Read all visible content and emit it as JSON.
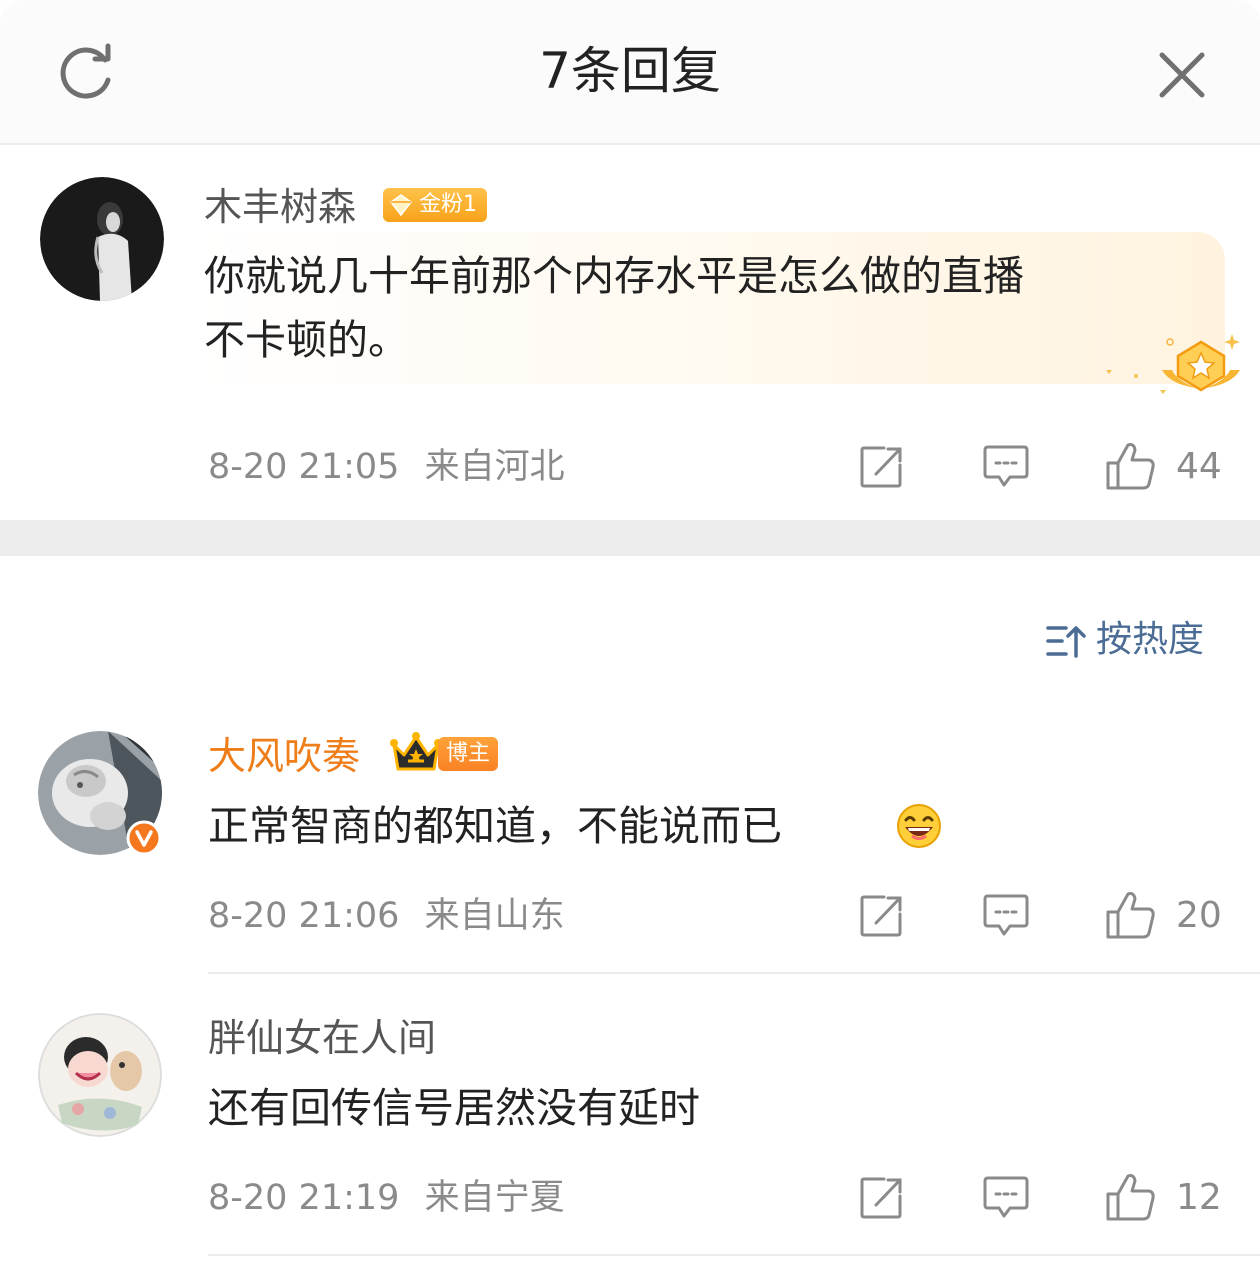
{
  "header": {
    "title": "7条回复"
  },
  "root_comment": {
    "user_name": "木丰树森",
    "fan_badge": "金粉1",
    "content_line1": "你就说几十年前那个内存水平是怎么做的直播",
    "content_line2": "不卡顿的。",
    "time": "8-20 21:05",
    "location": "来自河北",
    "likes": "44"
  },
  "sort": {
    "label": "按热度"
  },
  "replies": [
    {
      "user_name": "大风吹奏",
      "owner_badge": "博主",
      "content": "正常智商的都知道，不能说而已",
      "time": "8-20 21:06",
      "location": "来自山东",
      "likes": "20"
    },
    {
      "user_name": "胖仙女在人间",
      "content": "还有回传信号居然没有延时",
      "time": "8-20 21:19",
      "location": "来自宁夏",
      "likes": "12"
    }
  ],
  "colors": {
    "accent_orange": "#ee7d1a",
    "sort_blue": "#4b6c95",
    "meta_gray": "#8a8a8a"
  }
}
